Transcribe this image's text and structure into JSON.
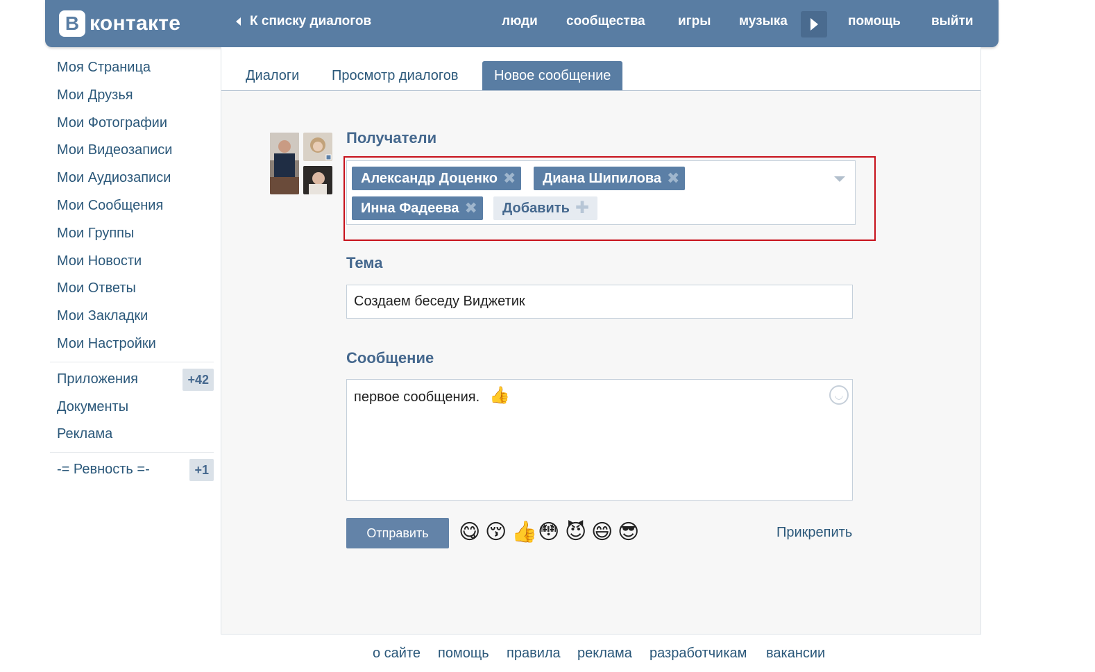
{
  "header": {
    "logo_letter": "В",
    "logo_text": "контакте",
    "back_label": "К списку диалогов",
    "nav": [
      "люди",
      "сообщества",
      "игры",
      "музыка",
      "помощь",
      "выйти"
    ]
  },
  "sidebar": {
    "items": [
      "Моя Страница",
      "Мои Друзья",
      "Мои Фотографии",
      "Мои Видеозаписи",
      "Мои Аудиозаписи",
      "Мои Сообщения",
      "Мои Группы",
      "Мои Новости",
      "Мои Ответы",
      "Мои Закладки",
      "Мои Настройки"
    ],
    "extra": [
      {
        "label": "Приложения",
        "badge": "+42"
      },
      {
        "label": "Документы"
      },
      {
        "label": "Реклама"
      }
    ],
    "group": {
      "label": "-= Ревность =-",
      "badge": "+1"
    }
  },
  "tabs": [
    "Диалоги",
    "Просмотр диалогов",
    "Новое сообщение"
  ],
  "form": {
    "recipients_label": "Получатели",
    "recipients": [
      "Александр Доценко",
      "Диана Шипилова",
      "Инна Фадеева"
    ],
    "add_label": "Добавить",
    "subject_label": "Тема",
    "subject_value": "Создаем беседу Виджетик",
    "message_label": "Сообщение",
    "message_value": "первое сообщения.",
    "send_label": "Отправить",
    "attach_label": "Прикрепить",
    "emojis": [
      "😋",
      "😚",
      "👍",
      "😳",
      "😈",
      "😄",
      "😎"
    ]
  },
  "footer": [
    "о сайте",
    "помощь",
    "правила",
    "реклама",
    "разработчикам",
    "вакансии"
  ],
  "colors": {
    "brand": "#597da3",
    "link": "#2b587a",
    "highlight": "#c7111b"
  }
}
